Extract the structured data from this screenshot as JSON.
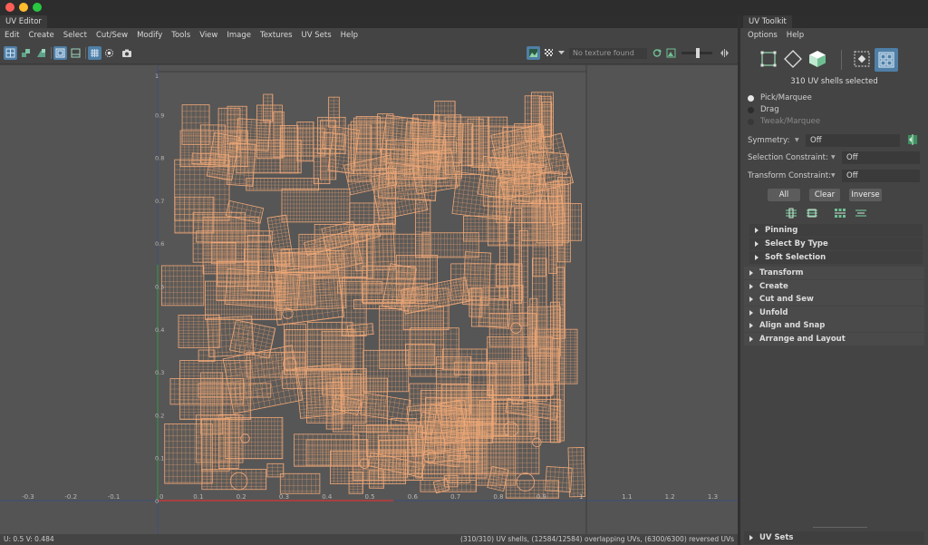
{
  "window": {
    "traffic_lights": {
      "close": "#fe5f57",
      "minimize": "#febc2e",
      "zoom": "#28c840"
    }
  },
  "editor": {
    "tab_title": "UV Editor",
    "menus": [
      "Edit",
      "Create",
      "Select",
      "Cut/Sew",
      "Modify",
      "Tools",
      "View",
      "Image",
      "Textures",
      "UV Sets",
      "Help"
    ],
    "texture_field": "No texture found",
    "toolbar_icons": [
      "uv-shell-icon",
      "uv-component-icon",
      "uv-face-icon",
      "grid-toggle-icon",
      "pixel-snap-icon",
      "grid-display-icon",
      "isolate-icon",
      "snapshot-icon",
      "image-display-icon",
      "checker-icon",
      "texture-menu-icon",
      "refresh-icon",
      "image-range-icon",
      "exposure-slider",
      "adjust-arrows-icon"
    ],
    "axis": {
      "x_ticks": [
        "-0.3",
        "-0.2",
        "-0.1",
        "0",
        "0.1",
        "0.2",
        "0.3",
        "0.4",
        "0.5",
        "0.6",
        "0.7",
        "0.8",
        "0.9",
        "1",
        "1.1",
        "1.2",
        "1.3"
      ],
      "y_ticks": [
        "1",
        "0.9",
        "0.8",
        "0.7",
        "0.6",
        "0.5",
        "0.4",
        "0.3",
        "0.2",
        "0.1",
        "0",
        "-0.1"
      ],
      "x_range": [
        -0.37,
        1.37
      ],
      "y_range": [
        -0.1,
        1.0
      ]
    },
    "wire_color": "#f0a878",
    "status_left": "U:  0.5  V:  0.484",
    "status_right": "(310/310) UV shells, (12584/12584) overlapping UVs, (6300/6300) reversed UVs"
  },
  "toolkit": {
    "tab_title": "UV Toolkit",
    "menus": [
      "Options",
      "Help"
    ],
    "selection_icons": [
      "bounding-box-icon",
      "uv-diamond-icon",
      "cube-icon",
      "shell-select-icon",
      "shell-grid-icon"
    ],
    "summary": "310 UV shells selected",
    "modes": [
      {
        "label": "Pick/Marquee",
        "selected": true,
        "enabled": true
      },
      {
        "label": "Drag",
        "selected": false,
        "enabled": true
      },
      {
        "label": "Tweak/Marquee",
        "selected": false,
        "enabled": false
      }
    ],
    "symmetry": {
      "label": "Symmetry:",
      "value": "Off"
    },
    "selection_constraint": {
      "label": "Selection Constraint:",
      "value": "Off"
    },
    "transform_constraint": {
      "label": "Transform Constraint:",
      "value": "Off"
    },
    "buttons": {
      "all": "All",
      "clear": "Clear",
      "inverse": "Inverse"
    },
    "grow_icons": [
      "grow-selection-icon",
      "shrink-selection-icon",
      "grow-loop-icon",
      "shrink-loop-icon"
    ],
    "sub_sections": [
      "Pinning",
      "Select By Type",
      "Soft Selection"
    ],
    "sections": [
      "Transform",
      "Create",
      "Cut and Sew",
      "Unfold",
      "Align and Snap",
      "Arrange and Layout"
    ],
    "bottom_section": "UV Sets"
  }
}
